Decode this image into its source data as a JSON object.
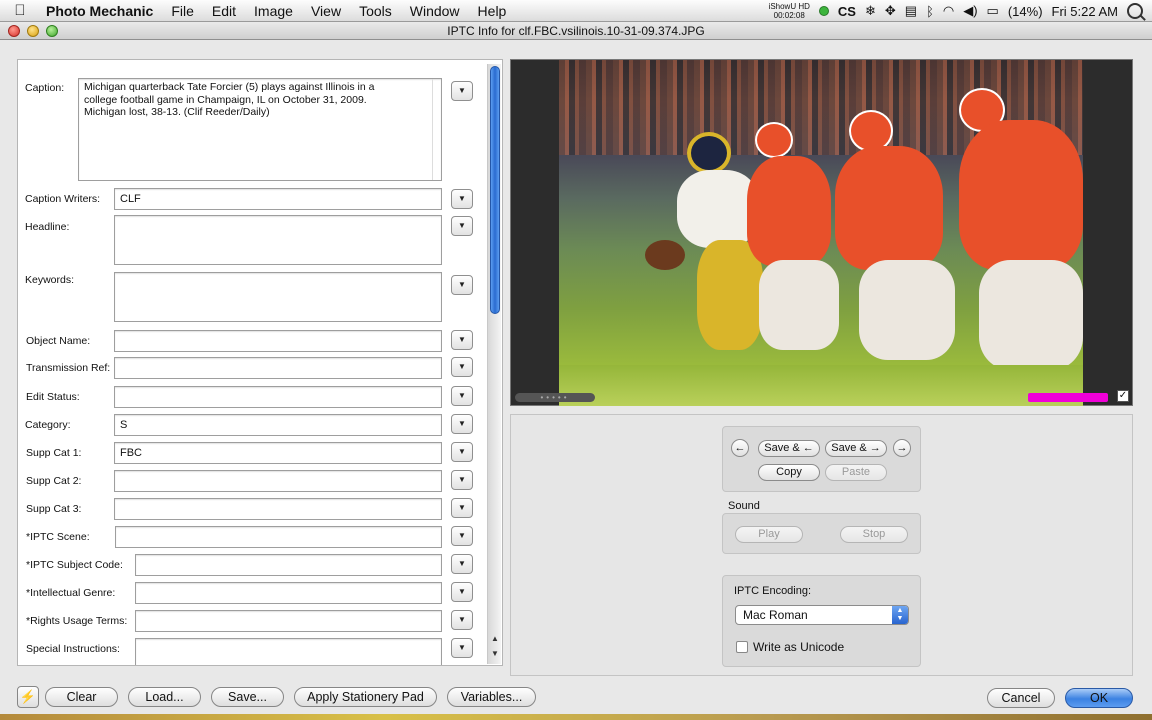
{
  "menubar": {
    "apple_icon": "apple-logo",
    "app_name": "Photo Mechanic",
    "items": [
      "File",
      "Edit",
      "Image",
      "View",
      "Tools",
      "Window",
      "Help"
    ],
    "ishow_line1": "iShowU HD",
    "ishow_line2": "00:02:08",
    "cs_label": "CS",
    "battery": "(14%)",
    "clock": "Fri 5:22 AM"
  },
  "window": {
    "title": "IPTC Info for clf.FBC.vsilinois.10-31-09.374.JPG"
  },
  "form": {
    "caption": {
      "label": "Caption:",
      "lines": [
        "Michigan quarterback Tate Forcier (5) plays against Illinois in a",
        "college football game in Champaign, IL on October 31, 2009.",
        "Michigan lost, 38-13. (Clif Reeder/Daily)"
      ]
    },
    "caption_writers": {
      "label": "Caption Writers:",
      "value": "CLF"
    },
    "headline": {
      "label": "Headline:",
      "value": ""
    },
    "keywords": {
      "label": "Keywords:",
      "value": ""
    },
    "object_name": {
      "label": "Object Name:",
      "value": ""
    },
    "transmission_ref": {
      "label": "Transmission Ref:",
      "value": ""
    },
    "edit_status": {
      "label": "Edit Status:",
      "value": ""
    },
    "category": {
      "label": "Category:",
      "value": "S"
    },
    "supp_cat_1": {
      "label": "Supp Cat 1:",
      "value": "FBC"
    },
    "supp_cat_2": {
      "label": "Supp Cat 2:",
      "value": ""
    },
    "supp_cat_3": {
      "label": "Supp Cat 3:",
      "value": ""
    },
    "iptc_scene": {
      "label": "*IPTC Scene:",
      "value": ""
    },
    "iptc_subject_code": {
      "label": "*IPTC Subject Code:",
      "value": ""
    },
    "intellectual_genre": {
      "label": "*Intellectual Genre:",
      "value": ""
    },
    "rights_usage_terms": {
      "label": "*Rights Usage Terms:",
      "value": ""
    },
    "special_instructions": {
      "label": "Special Instructions:",
      "value": ""
    },
    "dropdown_glyph": "▼"
  },
  "controls": {
    "prev_arrow": "←",
    "next_arrow": "→",
    "save_prev": "Save & ←",
    "save_next": "Save & →",
    "copy": "Copy",
    "paste": "Paste",
    "sound_label": "Sound",
    "play": "Play",
    "stop": "Stop",
    "encoding_label": "IPTC Encoding:",
    "encoding_value": "Mac Roman",
    "write_unicode_label": "Write as Unicode",
    "write_unicode_checked": false
  },
  "bottom": {
    "stationery_icon": "lightning-icon",
    "clear": "Clear",
    "load": "Load...",
    "save": "Save...",
    "apply_stationery": "Apply Stationery Pad",
    "variables": "Variables...",
    "cancel": "Cancel",
    "ok": "OK"
  },
  "colors": {
    "accent_blue": "#3c82e2",
    "color_class_magenta": "#f000d8",
    "illinois_orange": "#e8502a",
    "michigan_maize": "#d9b52a"
  }
}
